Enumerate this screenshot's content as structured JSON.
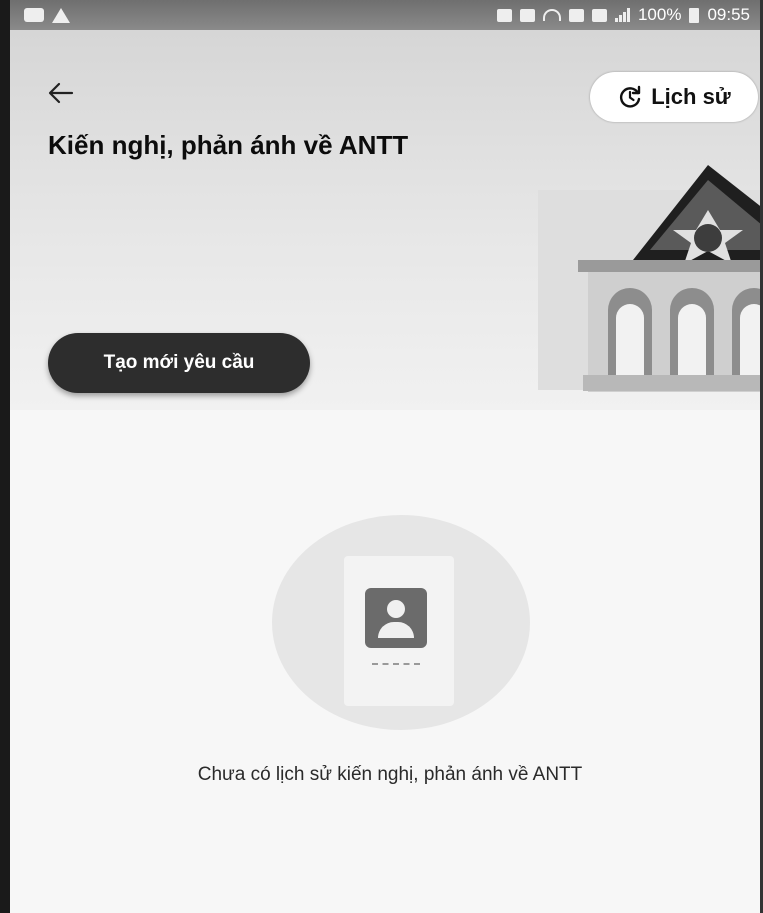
{
  "status_bar": {
    "battery_percent": "100%",
    "time": "09:55"
  },
  "header": {
    "back_icon": "arrow-left-icon",
    "history_label": "Lịch sử",
    "history_icon": "history-clock-icon",
    "title": "Kiến nghị, phản ánh về ANTT"
  },
  "actions": {
    "create_label": "Tạo mới yêu cầu"
  },
  "empty_state": {
    "illustration_icon": "document-user-icon",
    "message": "Chưa có lịch sử kiến nghị, phản ánh về ANTT"
  },
  "colors": {
    "primary_button": "#2d2d2d",
    "header_bg": "#d6d6d6"
  }
}
